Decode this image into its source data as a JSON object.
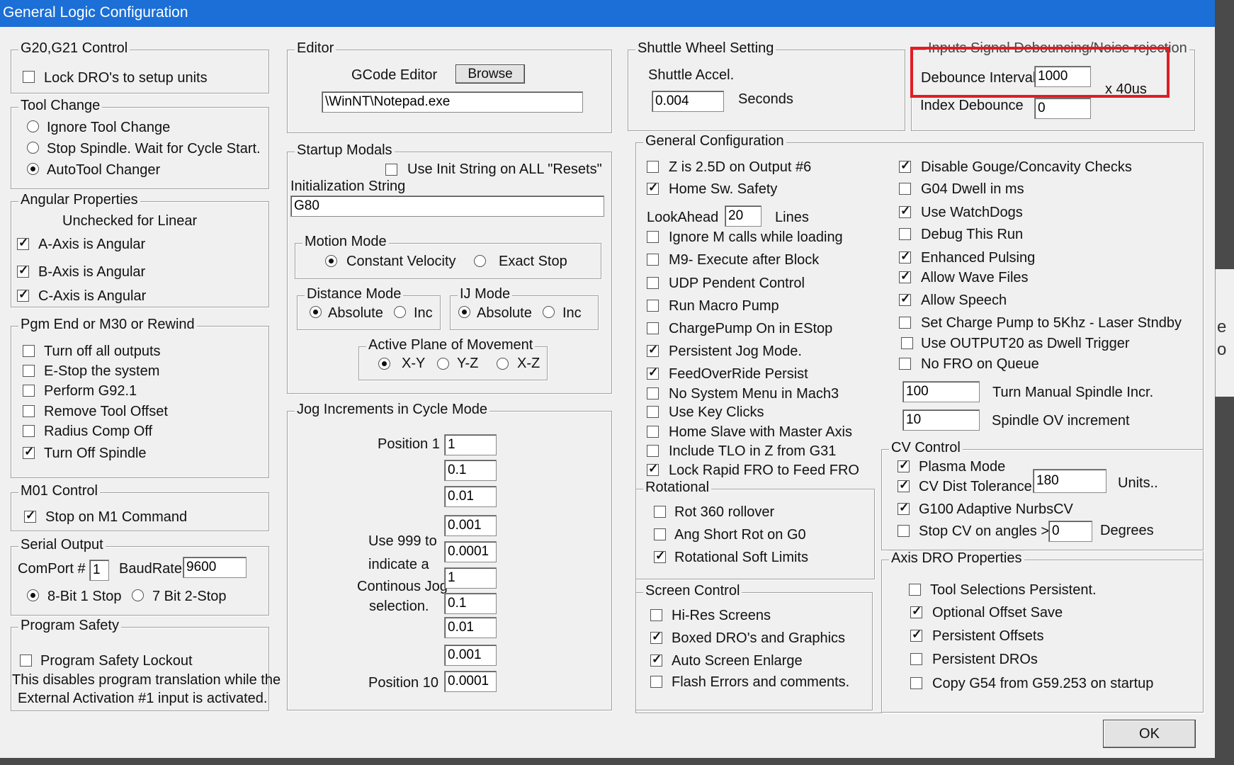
{
  "window": {
    "title": "General Logic Configuration"
  },
  "g20": {
    "title": "G20,G21 Control",
    "lock_dro": {
      "label": "Lock DRO's to setup units",
      "checked": false
    }
  },
  "tool_change": {
    "title": "Tool Change",
    "options": [
      "Ignore Tool Change",
      "Stop Spindle. Wait for Cycle Start.",
      "AutoTool Changer"
    ],
    "selected": "AutoTool Changer"
  },
  "angular": {
    "title": "Angular Properties",
    "note": "Unchecked for Linear",
    "a_axis": {
      "label": "A-Axis is Angular",
      "checked": true
    },
    "b_axis": {
      "label": "B-Axis is Angular",
      "checked": true
    },
    "c_axis": {
      "label": "C-Axis is Angular",
      "checked": true
    }
  },
  "pgm_end": {
    "title": "Pgm End or M30 or Rewind",
    "items": [
      {
        "label": "Turn off all outputs",
        "checked": false
      },
      {
        "label": "E-Stop the system",
        "checked": false
      },
      {
        "label": "Perform G92.1",
        "checked": false
      },
      {
        "label": "Remove Tool Offset",
        "checked": false
      },
      {
        "label": "Radius Comp Off",
        "checked": false
      },
      {
        "label": "Turn Off Spindle",
        "checked": true
      }
    ]
  },
  "m01": {
    "title": "M01 Control",
    "stop_m1": {
      "label": "Stop on M1 Command",
      "checked": true
    }
  },
  "serial": {
    "title": "Serial Output",
    "comport_label": "ComPort #",
    "comport_value": "1",
    "baud_label": "BaudRate",
    "baud_value": "9600",
    "bit8": "8-Bit 1 Stop",
    "bit7": "7 Bit 2-Stop",
    "selected": "8-Bit 1 Stop"
  },
  "safety": {
    "title": "Program Safety",
    "lockout": {
      "label": "Program Safety Lockout",
      "checked": false
    },
    "note_line1": "This disables program translation while the",
    "note_line2": "External Activation #1 input is activated."
  },
  "editor": {
    "title": "Editor",
    "gcode_label": "GCode Editor",
    "browse": "Browse",
    "path": "\\WinNT\\Notepad.exe"
  },
  "startup": {
    "title": "Startup Modals",
    "init_all": {
      "label": "Use Init String on ALL  \"Resets\"",
      "checked": false
    },
    "init_label": "Initialization String",
    "init_value": "G80"
  },
  "motion": {
    "title": "Motion Mode",
    "constant": "Constant Velocity",
    "exact": "Exact Stop",
    "selected": "Constant Velocity"
  },
  "distance": {
    "title": "Distance Mode",
    "absolute": "Absolute",
    "inc": "Inc",
    "selected": "Absolute"
  },
  "ij": {
    "title": "IJ Mode",
    "absolute": "Absolute",
    "inc": "Inc",
    "selected": "Absolute"
  },
  "plane": {
    "title": "Active Plane of Movement",
    "xy": "X-Y",
    "yz": "Y-Z",
    "xz": "X-Z",
    "selected": "X-Y"
  },
  "jog": {
    "title": "Jog Increments in Cycle Mode",
    "pos1": "Position 1",
    "pos10": "Position 10",
    "note1": "Use 999 to",
    "note2": "indicate a",
    "note3": "Continous Jog",
    "note4": "selection.",
    "values": [
      "1",
      "0.1",
      "0.01",
      "0.001",
      "0.0001",
      "1",
      "0.1",
      "0.01",
      "0.001",
      "0.0001"
    ]
  },
  "shuttle": {
    "title": "Shuttle Wheel Setting",
    "accel_label": "Shuttle Accel.",
    "accel_value": "0.004",
    "seconds": "Seconds"
  },
  "debounce": {
    "title": "Inputs Signal Debouncing/Noise rejection",
    "interval_label": "Debounce Interval:",
    "interval_value": "1000",
    "unit": "x 40us",
    "index_label": "Index Debounce",
    "index_value": "0"
  },
  "general": {
    "title": "General Configuration",
    "left": [
      {
        "label": "Z is 2.5D on Output #6",
        "checked": false
      },
      {
        "label": "Home Sw. Safety",
        "checked": true
      },
      {
        "label": "Ignore M calls while loading",
        "checked": false
      },
      {
        "label": "M9- Execute after Block",
        "checked": false
      },
      {
        "label": "UDP Pendent Control",
        "checked": false
      },
      {
        "label": "Run Macro Pump",
        "checked": false
      },
      {
        "label": "ChargePump On in EStop",
        "checked": false
      },
      {
        "label": "Persistent Jog Mode.",
        "checked": true
      },
      {
        "label": "FeedOverRide Persist",
        "checked": true
      },
      {
        "label": "No System Menu in Mach3",
        "checked": false
      },
      {
        "label": "Use Key Clicks",
        "checked": false
      },
      {
        "label": "Home Slave with Master Axis",
        "checked": false
      },
      {
        "label": "Include TLO in Z from G31",
        "checked": false
      },
      {
        "label": "Lock Rapid FRO to Feed FRO",
        "checked": true
      }
    ],
    "lookahead_label": "LookAhead",
    "lookahead_value": "20",
    "lines": "Lines",
    "right": [
      {
        "label": "Disable Gouge/Concavity Checks",
        "checked": true
      },
      {
        "label": "G04 Dwell in ms",
        "checked": false
      },
      {
        "label": "Use WatchDogs",
        "checked": true
      },
      {
        "label": "Debug This Run",
        "checked": false
      },
      {
        "label": "Enhanced Pulsing",
        "checked": true
      },
      {
        "label": "Allow Wave Files",
        "checked": true
      },
      {
        "label": "Allow Speech",
        "checked": true
      },
      {
        "label": "Set Charge Pump to 5Khz  - Laser Stndby",
        "checked": false
      },
      {
        "label": "Use OUTPUT20 as Dwell Trigger",
        "checked": false
      },
      {
        "label": "No FRO on Queue",
        "checked": false
      }
    ],
    "spindle_incr_value": "100",
    "spindle_incr_label": "Turn Manual Spindle Incr.",
    "spindle_ov_value": "10",
    "spindle_ov_label": "Spindle OV increment"
  },
  "rotational": {
    "title": "Rotational",
    "items": [
      {
        "label": "Rot 360 rollover",
        "checked": false
      },
      {
        "label": "Ang Short Rot on G0",
        "checked": false
      },
      {
        "label": "Rotational Soft Limits",
        "checked": true
      }
    ]
  },
  "screen": {
    "title": "Screen Control",
    "items": [
      {
        "label": "Hi-Res Screens",
        "checked": false
      },
      {
        "label": "Boxed DRO's and Graphics",
        "checked": true
      },
      {
        "label": "Auto Screen Enlarge",
        "checked": true
      },
      {
        "label": "Flash Errors and comments.",
        "checked": false
      }
    ]
  },
  "cv": {
    "title": "CV Control",
    "plasma": {
      "label": "Plasma Mode",
      "checked": true
    },
    "dist": {
      "label": "CV Dist Tolerance",
      "checked": true,
      "value": "180",
      "unit": "Units.."
    },
    "g100": {
      "label": "G100 Adaptive NurbsCV",
      "checked": true
    },
    "angles": {
      "label": "Stop CV on angles >",
      "checked": false,
      "value": "0",
      "unit": "Degrees"
    }
  },
  "axis_dro": {
    "title": "Axis DRO Properties",
    "items": [
      {
        "label": "Tool Selections Persistent.",
        "checked": false
      },
      {
        "label": "Optional Offset Save",
        "checked": true
      },
      {
        "label": "Persistent Offsets",
        "checked": true
      },
      {
        "label": "Persistent DROs",
        "checked": false
      },
      {
        "label": "Copy G54 from G59.253 on startup",
        "checked": false
      }
    ]
  },
  "ok_button": "OK",
  "background_window": {
    "fragment1": "e",
    "fragment2": "o"
  },
  "colors": {
    "titlebar": "#1b6fd6",
    "dialog_bg": "#f0f0f0",
    "highlight": "#e01c24"
  }
}
